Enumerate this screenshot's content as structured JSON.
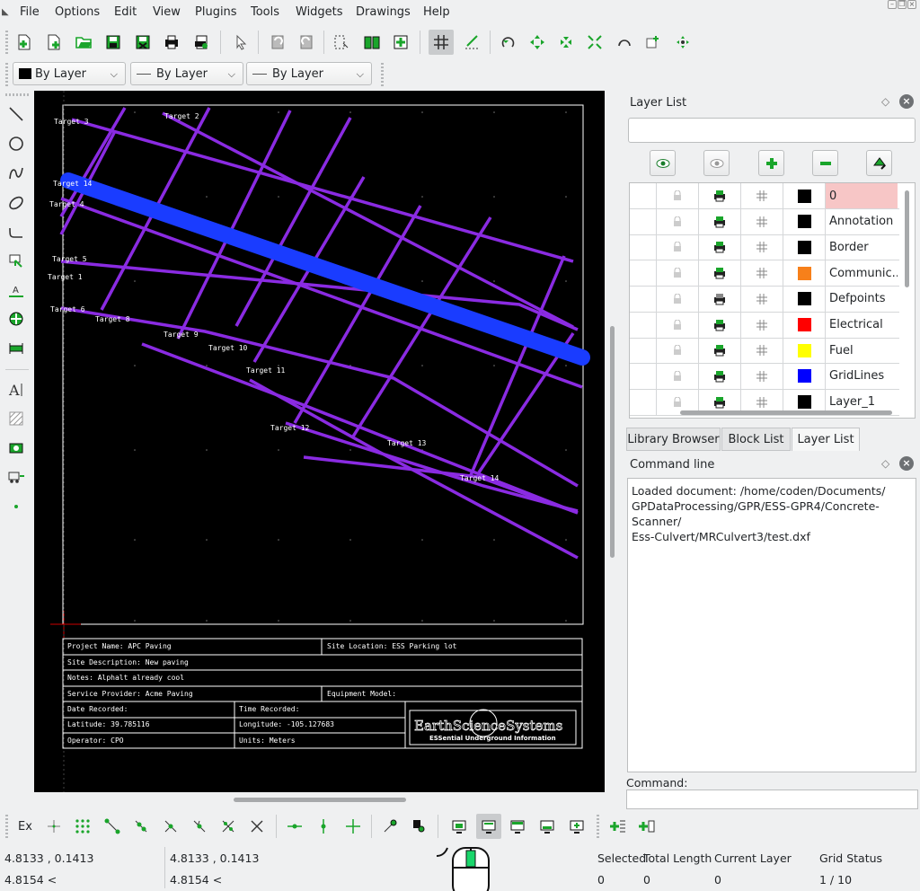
{
  "menu": [
    "File",
    "Options",
    "Edit",
    "View",
    "Plugins",
    "Tools",
    "Widgets",
    "Drawings",
    "Help"
  ],
  "pen": {
    "color_label": "By Layer",
    "width_label": "By Layer",
    "linetype_label": "By Layer"
  },
  "canvas": {
    "targets": [
      "Target 3",
      "Target 2",
      "Target 14",
      "Target 4",
      "Target 5",
      "Target 1",
      "Target 6",
      "Target 8",
      "Target 9",
      "Target 10",
      "Target 11",
      "Target 12",
      "Target 13",
      "Target 14"
    ],
    "title_block": {
      "project_name": "Project Name: APC Paving",
      "site_location": "Site Location: ESS Parking lot",
      "site_description": "Site Description: New paving",
      "notes": "Notes: Alphalt already cool",
      "service_provider": "Service Provider: Acme Paving",
      "equipment_model": "Equipment Model:",
      "date_recorded": "Date Recorded:",
      "time_recorded": "Time Recorded:",
      "latitude": "Latitude: 39.785116",
      "longitude": "Longitude: -105.127683",
      "operator": "Operator: CPO",
      "units": "Units: Meters",
      "logo_text": "EarthScienceSystems",
      "logo_tagline": "ESSential Underground Information"
    }
  },
  "layer_list": {
    "title": "Layer List",
    "layers": [
      {
        "name": "0",
        "color": "#000000",
        "selected": true
      },
      {
        "name": "Annotation",
        "color": "#000000"
      },
      {
        "name": "Border",
        "color": "#000000"
      },
      {
        "name": "Communic...",
        "color": "#f7801a"
      },
      {
        "name": "Defpoints",
        "color": "#000000"
      },
      {
        "name": "Electrical",
        "color": "#ff0000"
      },
      {
        "name": "Fuel",
        "color": "#ffff00"
      },
      {
        "name": "GridLines",
        "color": "#0000ff"
      },
      {
        "name": "Layer_1",
        "color": "#000000"
      }
    ]
  },
  "tabs": [
    "Library Browser",
    "Block List",
    "Layer List"
  ],
  "command_line": {
    "title": "Command line",
    "output_lines": [
      "Loaded document: /home/coden/Documents/",
      "GPDataProcessing/GPR/ESS-GPR4/Concrete-Scanner/",
      "Ess-Culvert/MRCulvert3/test.dxf"
    ],
    "prompt": "Command:"
  },
  "snap_toolbar": {
    "ex_label": "Ex"
  },
  "status": {
    "coord_abs_1": "4.8133 , 0.1413",
    "coord_abs_2": "4.8154 <",
    "coord_rel_1": "4.8133 , 0.1413",
    "coord_rel_2": "4.8154 <",
    "selected_label": "Selected",
    "selected_value": "0",
    "total_length_label": "Total Length",
    "total_length_value": "0",
    "current_layer_label": "Current Layer",
    "current_layer_value": "0",
    "grid_status_label": "Grid Status",
    "grid_status_value": "1 / 10"
  },
  "colors": {
    "canvas_bg": "#000000",
    "grid_lines": "#8a2be2",
    "pipe": "#1a3cff",
    "icon_green": "#1aa52b",
    "selected_row": "#f7c6c6"
  }
}
